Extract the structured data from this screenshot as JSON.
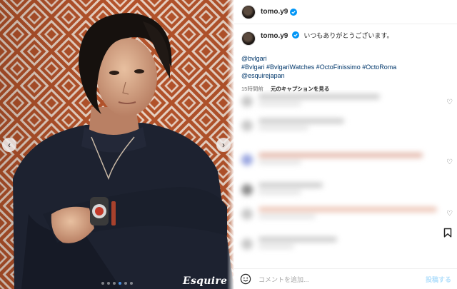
{
  "post": {
    "brand_mark": "Esquire",
    "carousel": {
      "count": 6,
      "active_index": 3
    }
  },
  "author": {
    "username": "tomo.y9",
    "verified": true
  },
  "caption": {
    "text": "いつもありがとうございます。",
    "tag_line1": "@bvlgari",
    "tag_line2": "#Bvlgari #BvlgariWatches #OctoFinissimo #OctoRoma",
    "tag_line3": "@esquirejapan",
    "time": "15時間前",
    "see_translation": "元のキャプションを見る"
  },
  "composer": {
    "placeholder": "コメントを追加...",
    "post_label": "投稿する"
  },
  "colors": {
    "verified_blue": "#0095f6",
    "link_blue": "#00376b",
    "post_disabled": "#b2dffc"
  }
}
